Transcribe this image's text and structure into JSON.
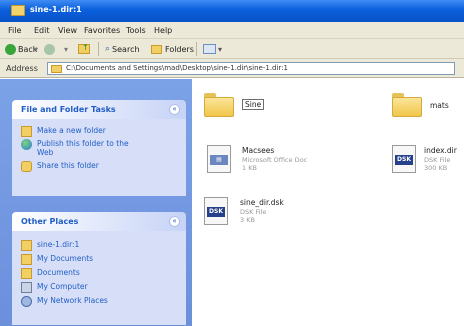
{
  "window": {
    "title": "sine-1.dir:1"
  },
  "menu": [
    "File",
    "Edit",
    "View",
    "Favorites",
    "Tools",
    "Help"
  ],
  "toolbar": {
    "back": "Back",
    "search": "Search",
    "folders": "Folders"
  },
  "address": {
    "label": "Address",
    "path": "C:\\Documents and Settings\\mad\\Desktop\\sine-1.dir\\sine-1.dir:1"
  },
  "tasks_panel": {
    "title": "File and Folder Tasks",
    "items": [
      {
        "label": "Make a new folder",
        "icon": "new-folder-icon"
      },
      {
        "label": "Publish this folder to the Web",
        "icon": "globe-icon"
      },
      {
        "label": "Share this folder",
        "icon": "share-folder-icon"
      }
    ]
  },
  "places_panel": {
    "title": "Other Places",
    "items": [
      {
        "label": "sine-1.dir:1",
        "icon": "folder-icon"
      },
      {
        "label": "My Documents",
        "icon": "my-documents-icon"
      },
      {
        "label": "Documents",
        "icon": "documents-icon"
      },
      {
        "label": "My Computer",
        "icon": "my-computer-icon"
      },
      {
        "label": "My Network Places",
        "icon": "network-places-icon"
      }
    ]
  },
  "files": [
    {
      "name": "Sine",
      "type": "folder",
      "sub1": "",
      "sub2": ""
    },
    {
      "name": "mats",
      "type": "folder",
      "sub1": "",
      "sub2": ""
    },
    {
      "name": "Macsees",
      "type": "doc",
      "sub1": "Microsoft Office Doc",
      "sub2": "1 KB"
    },
    {
      "name": "index.dir",
      "type": "dsk",
      "sub1": "DSK File",
      "sub2": "300 KB"
    },
    {
      "name": "sine_dir.dsk",
      "type": "dsk",
      "sub1": "DSK File",
      "sub2": "3 KB"
    }
  ],
  "colors": {
    "title_bar": "#0a5fdc",
    "task_pane": "#6c8fdc",
    "link": "#215dc6"
  }
}
